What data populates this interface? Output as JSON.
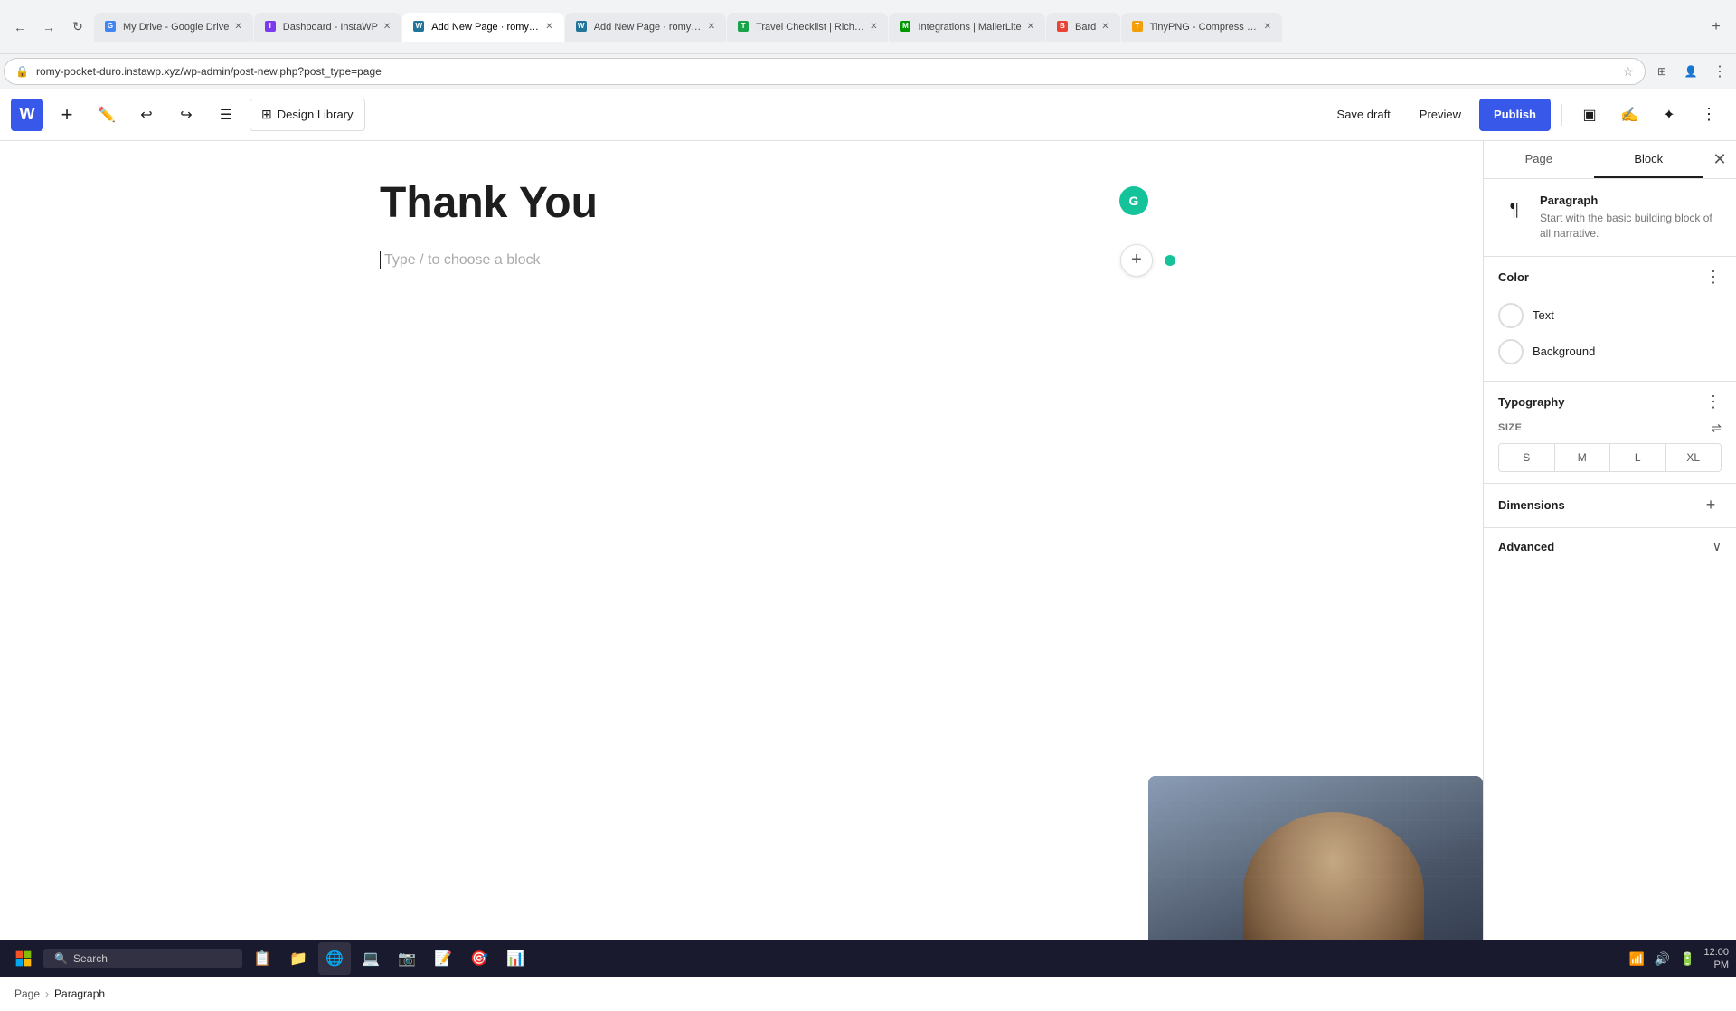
{
  "browser": {
    "tabs": [
      {
        "id": "google-drive",
        "favicon_color": "#4285f4",
        "favicon_letter": "G",
        "label": "My Drive - Google Drive",
        "active": false
      },
      {
        "id": "instawp-dashboard",
        "favicon_color": "#7c3aed",
        "favicon_letter": "I",
        "label": "Dashboard - InstaWP",
        "active": false
      },
      {
        "id": "add-new-page-1",
        "favicon_color": "#21759b",
        "favicon_letter": "W",
        "label": "Add New Page · romy-po...",
        "active": true
      },
      {
        "id": "add-new-page-2",
        "favicon_color": "#21759b",
        "favicon_letter": "W",
        "label": "Add New Page · romy-po...",
        "active": false
      },
      {
        "id": "travel-checklist",
        "favicon_color": "#16a34a",
        "favicon_letter": "T",
        "label": "Travel Checklist | Rich te...",
        "active": false
      },
      {
        "id": "mailerlite",
        "favicon_color": "#009900",
        "favicon_letter": "M",
        "label": "Integrations | MailerLite",
        "active": false
      },
      {
        "id": "bard",
        "favicon_color": "#ea4335",
        "favicon_letter": "B",
        "label": "Bard",
        "active": false
      },
      {
        "id": "tinypng",
        "favicon_color": "#f59e0b",
        "favicon_letter": "T",
        "label": "TinyPNG - Compress We...",
        "active": false
      }
    ],
    "address": "romy-pocket-duro.instawp.xyz/wp-admin/post-new.php?post_type=page"
  },
  "wordpress": {
    "toolbar": {
      "add_label": "+",
      "design_library_label": "Design Library",
      "save_draft_label": "Save draft",
      "preview_label": "Preview",
      "publish_label": "Publish"
    },
    "editor": {
      "page_title": "Thank You",
      "placeholder": "Type / to choose a block"
    }
  },
  "right_panel": {
    "tabs": [
      {
        "id": "page",
        "label": "Page"
      },
      {
        "id": "block",
        "label": "Block"
      }
    ],
    "active_tab": "block",
    "block_info": {
      "name": "Paragraph",
      "description": "Start with the basic building block of all narrative."
    },
    "color": {
      "title": "Color",
      "text_label": "Text",
      "background_label": "Background"
    },
    "typography": {
      "title": "Typography",
      "size_label": "SIZE",
      "sizes": [
        "S",
        "M",
        "L",
        "XL"
      ]
    },
    "dimensions": {
      "title": "Dimensions"
    },
    "advanced": {
      "title": "Advanced"
    }
  },
  "breadcrumb": {
    "items": [
      "Page",
      "Paragraph"
    ],
    "separator": "›"
  },
  "taskbar": {
    "search_placeholder": "Search",
    "time": "12:00"
  }
}
